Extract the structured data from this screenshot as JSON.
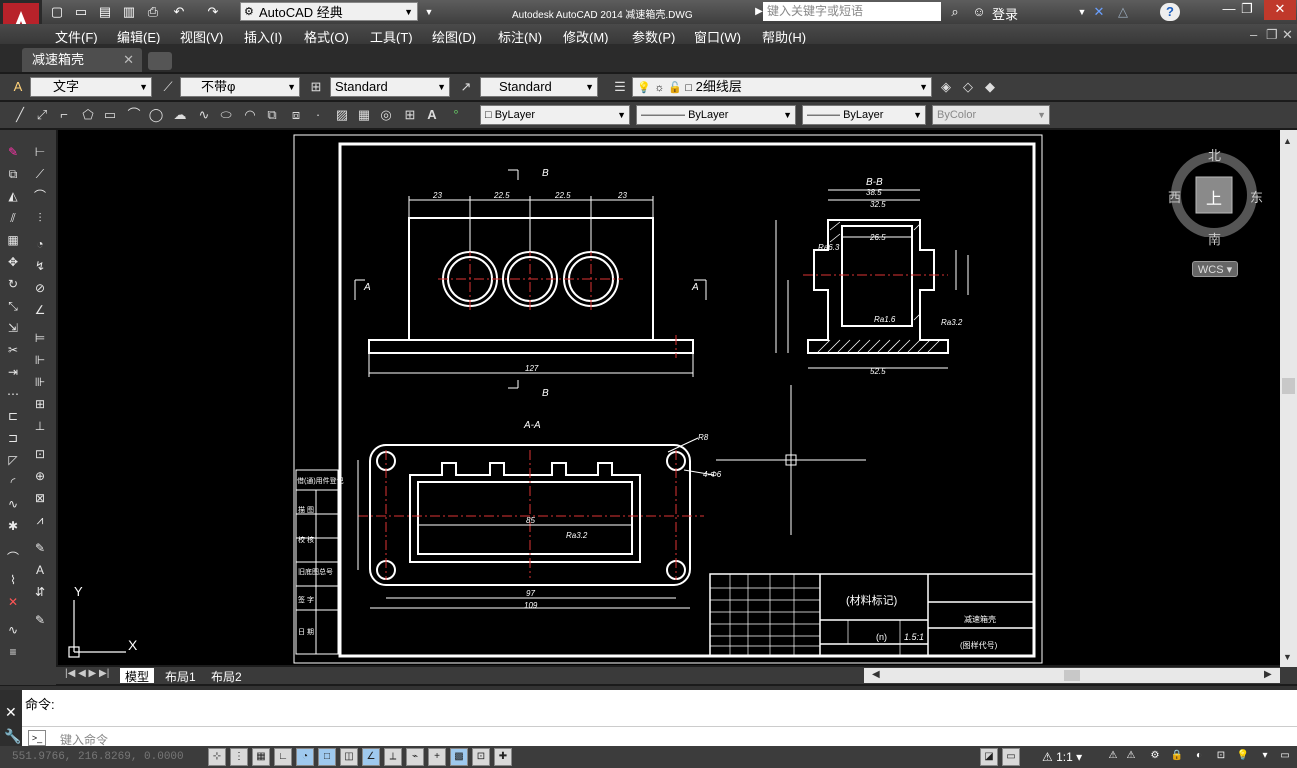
{
  "app": {
    "title": "Autodesk AutoCAD 2014    减速箱壳.DWG",
    "workspace": "AutoCAD 经典",
    "search_placeholder": "键入关键字或短语",
    "login": "登录"
  },
  "menu": [
    "文件(F)",
    "编辑(E)",
    "视图(V)",
    "插入(I)",
    "格式(O)",
    "工具(T)",
    "绘图(D)",
    "标注(N)",
    "修改(M)",
    "参数(P)",
    "窗口(W)",
    "帮助(H)"
  ],
  "doc_tab": "减速箱壳",
  "styles_toolbar": {
    "text_style": "文字",
    "dim_style": "不带φ",
    "table_style": "Standard",
    "multileader_style": "Standard"
  },
  "layers_toolbar": {
    "layer": "2细线层"
  },
  "properties_toolbar": {
    "color": "ByLayer",
    "linetype": "ByLayer",
    "lineweight": "ByLayer",
    "plotstyle": "ByColor"
  },
  "viewcube": {
    "north": "北",
    "south": "南",
    "east": "东",
    "west": "西",
    "top": "上",
    "wcs": "WCS"
  },
  "ucs": {
    "x": "X",
    "y": "Y"
  },
  "layout_tabs": [
    "模型",
    "布局1",
    "布局2"
  ],
  "command": {
    "history": "命令:",
    "placeholder": "键入命令"
  },
  "status": {
    "coords": "551.9766, 216.8269, 0.0000",
    "scale": "1:1"
  },
  "drawing": {
    "section_bb": "B-B",
    "section_aa": "A-A",
    "label_a": "A",
    "label_b": "B",
    "dims_top": [
      "23",
      "22.5",
      "22.5",
      "23"
    ],
    "dim_overall": "127",
    "dims_side": [
      "38.5",
      "32.5",
      "26.5",
      "52.5",
      "37",
      "35",
      "7"
    ],
    "dims_plan": [
      "85",
      "97",
      "109",
      "44.5",
      "4-Φ6",
      "R8"
    ],
    "roughness": [
      "Ra3.2",
      "Ra1.6",
      "Ra6.3",
      "Ra3.2"
    ],
    "title_block": {
      "material": "(材料标记)",
      "name": "减速箱壳",
      "drawing_no": "(图样代号)",
      "scale": "1.5:1",
      "sheet": "(n)"
    },
    "side_table": [
      "借(通)用件登记",
      "描  图",
      "校  核",
      "旧底图总号",
      "签  字",
      "日  期"
    ]
  }
}
